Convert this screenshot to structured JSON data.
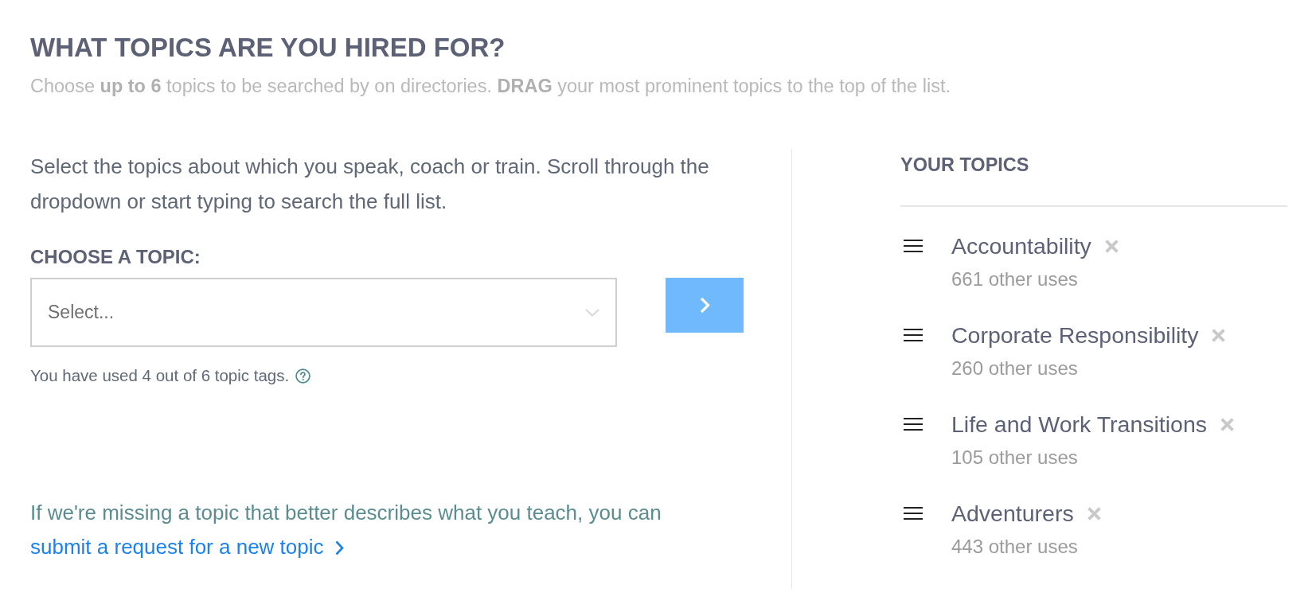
{
  "header": {
    "title": "WHAT TOPICS ARE YOU HIRED FOR?",
    "subtitle": "Choose **up to 6** topics to be searched by on directories. **DRAG** your most prominent topics to the top of the list."
  },
  "chooser": {
    "intro": "Select the topics about which you speak, coach or train. Scroll through the dropdown or start typing to search the full list.",
    "label": "CHOOSE A TOPIC:",
    "select": {
      "placeholder": "Select..."
    },
    "usage_note": "You have used 4 out of 6 topic tags.",
    "missing_note": {
      "text": "If we're missing a topic that better describes what you teach, you can ",
      "link": "submit a request for a new topic"
    }
  },
  "your_topics": {
    "heading": "YOUR TOPICS",
    "items": [
      {
        "name": "Accountability",
        "uses": "661 other uses"
      },
      {
        "name": "Corporate Responsibility",
        "uses": "260 other uses"
      },
      {
        "name": "Life and Work Transitions",
        "uses": "105 other uses"
      },
      {
        "name": "Adventurers",
        "uses": "443 other uses"
      }
    ]
  }
}
